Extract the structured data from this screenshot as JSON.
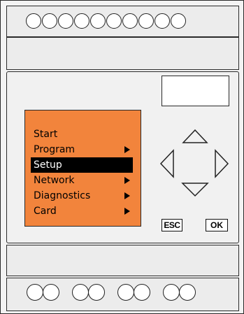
{
  "device": {
    "top_terminal_count": 10,
    "bottom_terminal_groups": 4,
    "bottom_terminals_per_group": 2
  },
  "lcd": {
    "background_color": "#f2843c",
    "menu": [
      {
        "label": "Start",
        "selected": false,
        "has_submenu": false
      },
      {
        "label": "Program",
        "selected": false,
        "has_submenu": true
      },
      {
        "label": "Setup",
        "selected": true,
        "has_submenu": false
      },
      {
        "label": "Network",
        "selected": false,
        "has_submenu": true
      },
      {
        "label": "Diagnostics",
        "selected": false,
        "has_submenu": true
      },
      {
        "label": "Card",
        "selected": false,
        "has_submenu": true
      }
    ]
  },
  "keypad": {
    "up_icon": "triangle-up-icon",
    "down_icon": "triangle-down-icon",
    "left_icon": "triangle-left-icon",
    "right_icon": "triangle-right-icon",
    "esc_label": "ESC",
    "ok_label": "OK"
  }
}
